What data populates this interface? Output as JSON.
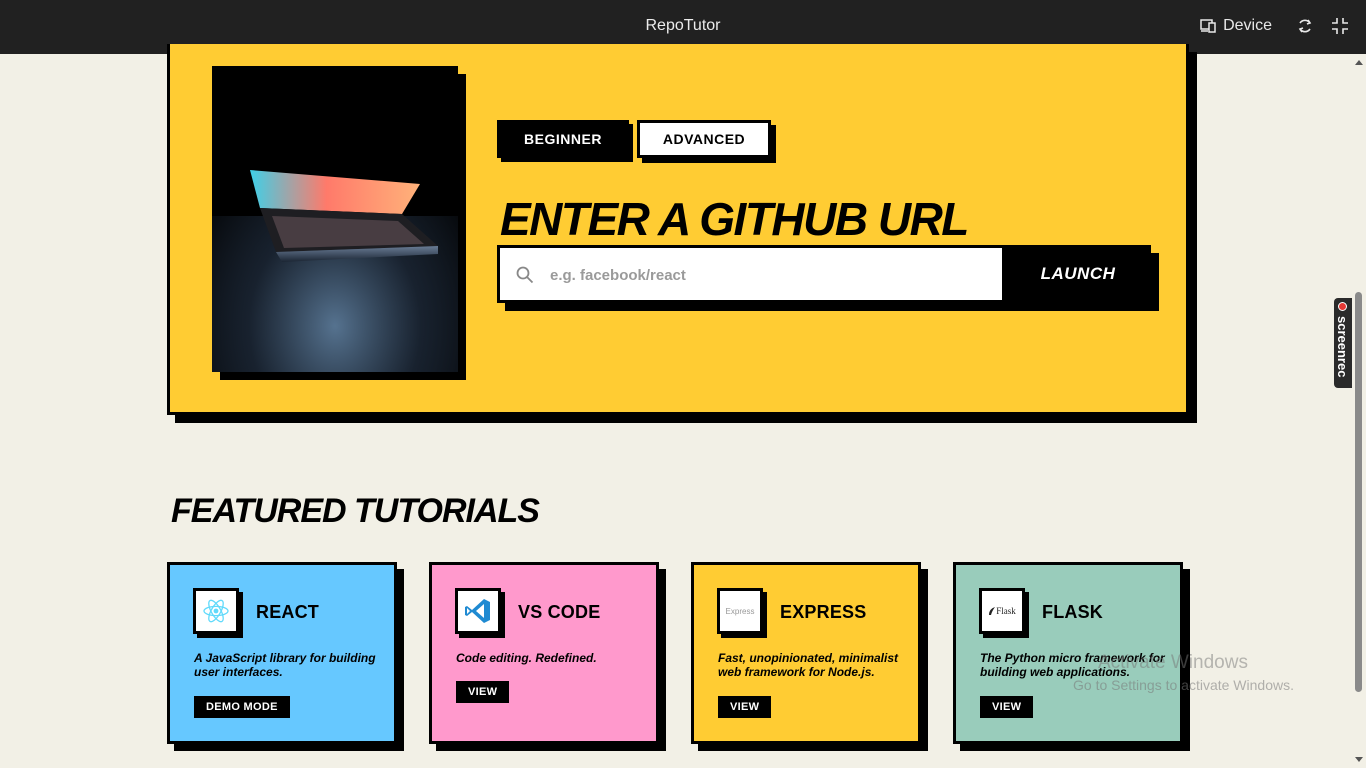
{
  "window": {
    "title": "RepoTutor",
    "device_label": "Device"
  },
  "hero": {
    "tabs": [
      {
        "label": "BEGINNER",
        "active": true
      },
      {
        "label": "ADVANCED",
        "active": false
      }
    ],
    "heading": "ENTER A GITHUB URL",
    "search_placeholder": "e.g. facebook/react",
    "launch_label": "LAUNCH"
  },
  "featured": {
    "heading": "FEATURED TUTORIALS",
    "cards": [
      {
        "name": "REACT",
        "description": "A JavaScript library for building user interfaces.",
        "button": "DEMO MODE",
        "color": "#66c8ff",
        "icon": "react-logo-icon"
      },
      {
        "name": "VS CODE",
        "description": "Code editing. Redefined.",
        "button": "VIEW",
        "color": "#ff99cc",
        "icon": "vscode-logo-icon"
      },
      {
        "name": "EXPRESS",
        "description": "Fast, unopinionated, minimalist web framework for Node.js.",
        "button": "VIEW",
        "color": "#ffcc33",
        "icon": "express-logo-icon",
        "logo_text": "Express"
      },
      {
        "name": "FLASK",
        "description": "The Python micro framework for building web applications.",
        "button": "VIEW",
        "color": "#99ccbb",
        "icon": "flask-logo-icon",
        "logo_text": "Flask"
      }
    ]
  },
  "overlay": {
    "activate_title": "Activate Windows",
    "activate_subtitle": "Go to Settings to activate Windows.",
    "recorder_label": "screenrec"
  },
  "colors": {
    "background": "#f2f0e6",
    "accent_yellow": "#ffcc33",
    "topbar": "#212121"
  }
}
